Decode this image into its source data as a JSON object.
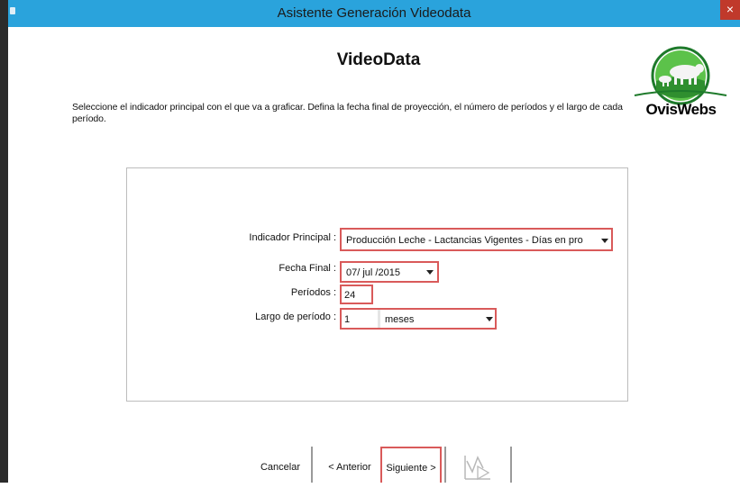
{
  "window": {
    "title": "Asistente Generación Videodata",
    "close_glyph": "×"
  },
  "heading": "VideoData",
  "description": "Seleccione el indicador principal con el que va a graficar. Defina la fecha final de proyección, el número de períodos y el largo de cada período.",
  "logo": {
    "text": "OvisWebs"
  },
  "form": {
    "indicador_label": "Indicador Principal :",
    "indicador_value": "Producción Leche - Lactancias Vigentes - Días en pro",
    "fecha_label": "Fecha Final :",
    "fecha_value": "07/ jul /2015",
    "periodos_label": "Períodos :",
    "periodos_value": "24",
    "largo_label": "Largo de período :",
    "largo_value": "1",
    "largo_unit": "meses"
  },
  "buttons": {
    "cancel": "Cancelar",
    "previous": "< Anterior",
    "next": "Siguiente >"
  },
  "colors": {
    "titlebar": "#2aa3dc",
    "highlight": "#d95a5a"
  }
}
